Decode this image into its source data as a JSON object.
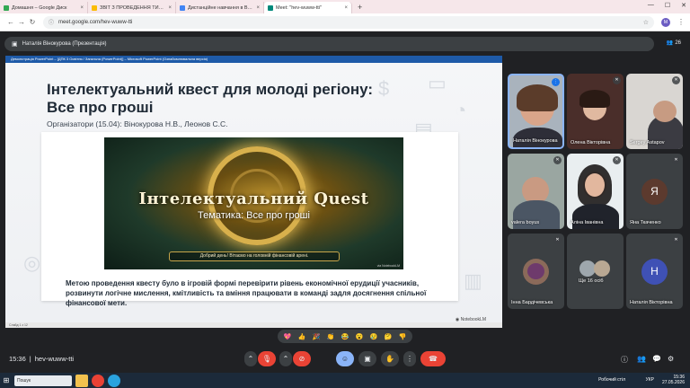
{
  "browser": {
    "tabs": [
      {
        "label": "Домашня – Google Диск",
        "favicon_color": "#34a853",
        "active": false
      },
      {
        "label": "ЗВІТ З ПРОВЕДЕННЯ ТИЖНЕ…",
        "favicon_color": "#fbbc04",
        "active": false
      },
      {
        "label": "Дистанційне навчання в ВСП…",
        "favicon_color": "#4285f4",
        "active": false
      },
      {
        "label": "Meet: \"hev-wuww-tti\"",
        "favicon_color": "#00897b",
        "active": true
      }
    ],
    "url": "meet.google.com/hev-wuww-tti",
    "profile_initial": "M"
  },
  "meet": {
    "presenter_label": "Наталія Вінокурова (Презентація)",
    "people_count": "26",
    "meeting_code": "hev-wuww-tti",
    "time": "15:36"
  },
  "presentation": {
    "share_header": "Демонстрація PowerPoint – [ДПК 3 Освітня / Загальна (PowerPoint)] – Microsoft PowerPoint (Ознайомлювальна версія)",
    "title": "Інтелектуальний квест для молоді регіону: Все про гроші",
    "subtitle": "Організатори (15.04): Вінокурова Н.В., Леонов С.С.",
    "image": {
      "title_line1": "Інтелектуальний Quest",
      "title_line2": "Тематика: Все про гроші",
      "greeting": "Добрий день! Вітаємо на головній фінансовій арені.",
      "watermark": "via NotebookLM"
    },
    "body": "Метою проведення квесту було в ігровій формі перевірити рівень економічної ерудиції учасників, розвинути логічне мислення, кмітливість та вміння працювати в команді задля досягнення спільної фінансової мети.",
    "brand": "NotebookLM",
    "status": "Слайд 1 з 12"
  },
  "participants": [
    {
      "name": "Наталія Вінокурова",
      "type": "video",
      "mic": "muted"
    },
    {
      "name": "Олена Вікторівна",
      "type": "video",
      "mic": "muted"
    },
    {
      "name": "Sergey Astapov",
      "type": "video",
      "mic": "muted"
    },
    {
      "name": "valera boyus",
      "type": "video",
      "mic": "muted"
    },
    {
      "name": "Аліна Іванівна",
      "type": "video",
      "mic": "muted"
    },
    {
      "name": "Яна Ткаченко",
      "type": "avatar",
      "initial": "Я",
      "color": "#5c3a2e",
      "mic": "muted"
    },
    {
      "name": "Інна Бардічевська",
      "type": "photo",
      "mic": "muted"
    },
    {
      "name": "Ще 16 осіб",
      "type": "more"
    },
    {
      "name": "Наталія Вікторівна",
      "type": "avatar",
      "initial": "Н",
      "color": "#3f51b5",
      "mic": "muted"
    }
  ],
  "reactions": [
    "💖",
    "👍",
    "🎉",
    "👏",
    "😂",
    "😮",
    "😢",
    "🤔",
    "👎"
  ],
  "controls": {
    "mic_icon": "mic-off-icon",
    "camera_icon": "camera-off-icon",
    "emoji_icon": "emoji-icon",
    "present_icon": "present-icon",
    "hand_icon": "raise-hand-icon",
    "more_icon": "more-options-icon",
    "end_icon": "end-call-icon"
  },
  "taskbar": {
    "search_placeholder": "Пошук",
    "tray_label": "Робочий стіл",
    "lang": "УКР",
    "time": "15:36",
    "date": "27.05.2026"
  }
}
